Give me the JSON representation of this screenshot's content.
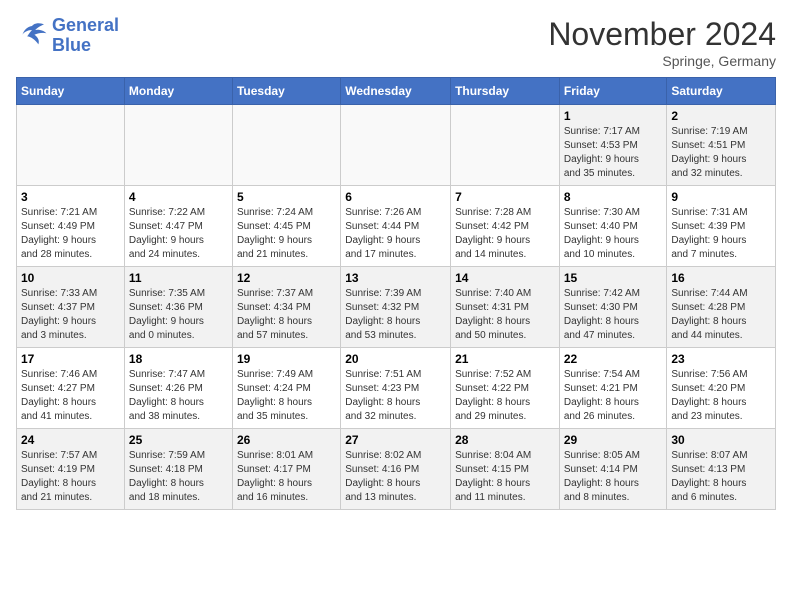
{
  "logo": {
    "line1": "General",
    "line2": "Blue"
  },
  "title": "November 2024",
  "location": "Springe, Germany",
  "days_of_week": [
    "Sunday",
    "Monday",
    "Tuesday",
    "Wednesday",
    "Thursday",
    "Friday",
    "Saturday"
  ],
  "weeks": [
    [
      {
        "day": "",
        "info": ""
      },
      {
        "day": "",
        "info": ""
      },
      {
        "day": "",
        "info": ""
      },
      {
        "day": "",
        "info": ""
      },
      {
        "day": "",
        "info": ""
      },
      {
        "day": "1",
        "info": "Sunrise: 7:17 AM\nSunset: 4:53 PM\nDaylight: 9 hours\nand 35 minutes."
      },
      {
        "day": "2",
        "info": "Sunrise: 7:19 AM\nSunset: 4:51 PM\nDaylight: 9 hours\nand 32 minutes."
      }
    ],
    [
      {
        "day": "3",
        "info": "Sunrise: 7:21 AM\nSunset: 4:49 PM\nDaylight: 9 hours\nand 28 minutes."
      },
      {
        "day": "4",
        "info": "Sunrise: 7:22 AM\nSunset: 4:47 PM\nDaylight: 9 hours\nand 24 minutes."
      },
      {
        "day": "5",
        "info": "Sunrise: 7:24 AM\nSunset: 4:45 PM\nDaylight: 9 hours\nand 21 minutes."
      },
      {
        "day": "6",
        "info": "Sunrise: 7:26 AM\nSunset: 4:44 PM\nDaylight: 9 hours\nand 17 minutes."
      },
      {
        "day": "7",
        "info": "Sunrise: 7:28 AM\nSunset: 4:42 PM\nDaylight: 9 hours\nand 14 minutes."
      },
      {
        "day": "8",
        "info": "Sunrise: 7:30 AM\nSunset: 4:40 PM\nDaylight: 9 hours\nand 10 minutes."
      },
      {
        "day": "9",
        "info": "Sunrise: 7:31 AM\nSunset: 4:39 PM\nDaylight: 9 hours\nand 7 minutes."
      }
    ],
    [
      {
        "day": "10",
        "info": "Sunrise: 7:33 AM\nSunset: 4:37 PM\nDaylight: 9 hours\nand 3 minutes."
      },
      {
        "day": "11",
        "info": "Sunrise: 7:35 AM\nSunset: 4:36 PM\nDaylight: 9 hours\nand 0 minutes."
      },
      {
        "day": "12",
        "info": "Sunrise: 7:37 AM\nSunset: 4:34 PM\nDaylight: 8 hours\nand 57 minutes."
      },
      {
        "day": "13",
        "info": "Sunrise: 7:39 AM\nSunset: 4:32 PM\nDaylight: 8 hours\nand 53 minutes."
      },
      {
        "day": "14",
        "info": "Sunrise: 7:40 AM\nSunset: 4:31 PM\nDaylight: 8 hours\nand 50 minutes."
      },
      {
        "day": "15",
        "info": "Sunrise: 7:42 AM\nSunset: 4:30 PM\nDaylight: 8 hours\nand 47 minutes."
      },
      {
        "day": "16",
        "info": "Sunrise: 7:44 AM\nSunset: 4:28 PM\nDaylight: 8 hours\nand 44 minutes."
      }
    ],
    [
      {
        "day": "17",
        "info": "Sunrise: 7:46 AM\nSunset: 4:27 PM\nDaylight: 8 hours\nand 41 minutes."
      },
      {
        "day": "18",
        "info": "Sunrise: 7:47 AM\nSunset: 4:26 PM\nDaylight: 8 hours\nand 38 minutes."
      },
      {
        "day": "19",
        "info": "Sunrise: 7:49 AM\nSunset: 4:24 PM\nDaylight: 8 hours\nand 35 minutes."
      },
      {
        "day": "20",
        "info": "Sunrise: 7:51 AM\nSunset: 4:23 PM\nDaylight: 8 hours\nand 32 minutes."
      },
      {
        "day": "21",
        "info": "Sunrise: 7:52 AM\nSunset: 4:22 PM\nDaylight: 8 hours\nand 29 minutes."
      },
      {
        "day": "22",
        "info": "Sunrise: 7:54 AM\nSunset: 4:21 PM\nDaylight: 8 hours\nand 26 minutes."
      },
      {
        "day": "23",
        "info": "Sunrise: 7:56 AM\nSunset: 4:20 PM\nDaylight: 8 hours\nand 23 minutes."
      }
    ],
    [
      {
        "day": "24",
        "info": "Sunrise: 7:57 AM\nSunset: 4:19 PM\nDaylight: 8 hours\nand 21 minutes."
      },
      {
        "day": "25",
        "info": "Sunrise: 7:59 AM\nSunset: 4:18 PM\nDaylight: 8 hours\nand 18 minutes."
      },
      {
        "day": "26",
        "info": "Sunrise: 8:01 AM\nSunset: 4:17 PM\nDaylight: 8 hours\nand 16 minutes."
      },
      {
        "day": "27",
        "info": "Sunrise: 8:02 AM\nSunset: 4:16 PM\nDaylight: 8 hours\nand 13 minutes."
      },
      {
        "day": "28",
        "info": "Sunrise: 8:04 AM\nSunset: 4:15 PM\nDaylight: 8 hours\nand 11 minutes."
      },
      {
        "day": "29",
        "info": "Sunrise: 8:05 AM\nSunset: 4:14 PM\nDaylight: 8 hours\nand 8 minutes."
      },
      {
        "day": "30",
        "info": "Sunrise: 8:07 AM\nSunset: 4:13 PM\nDaylight: 8 hours\nand 6 minutes."
      }
    ]
  ]
}
